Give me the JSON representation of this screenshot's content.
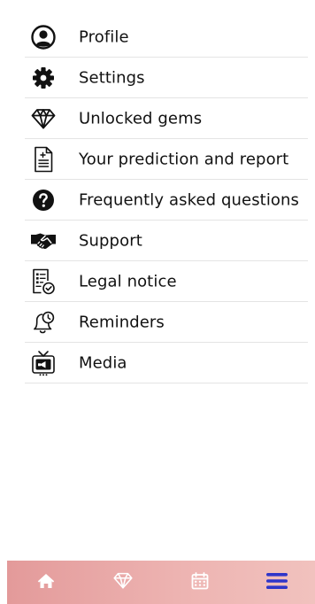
{
  "menu": {
    "items": [
      {
        "label": "Profile",
        "icon": "profile-icon"
      },
      {
        "label": "Settings",
        "icon": "gear-icon"
      },
      {
        "label": "Unlocked gems",
        "icon": "gem-icon"
      },
      {
        "label": "Your prediction and report",
        "icon": "document-icon"
      },
      {
        "label": "Frequently asked questions",
        "icon": "question-icon"
      },
      {
        "label": "Support",
        "icon": "handshake-icon"
      },
      {
        "label": "Legal notice",
        "icon": "legal-document-icon"
      },
      {
        "label": "Reminders",
        "icon": "bell-clock-icon"
      },
      {
        "label": "Media",
        "icon": "tv-icon"
      }
    ]
  },
  "tabbar": {
    "tabs": [
      {
        "icon": "home-icon",
        "active": false
      },
      {
        "icon": "gem-icon",
        "active": false
      },
      {
        "icon": "calendar-icon",
        "active": false
      },
      {
        "icon": "hamburger-menu-icon",
        "active": true
      }
    ],
    "colors": {
      "gradient_start": "#e39a9a",
      "gradient_end": "#f1c2be",
      "icon_inactive": "#ffffff",
      "icon_active": "#2f35c9"
    }
  }
}
